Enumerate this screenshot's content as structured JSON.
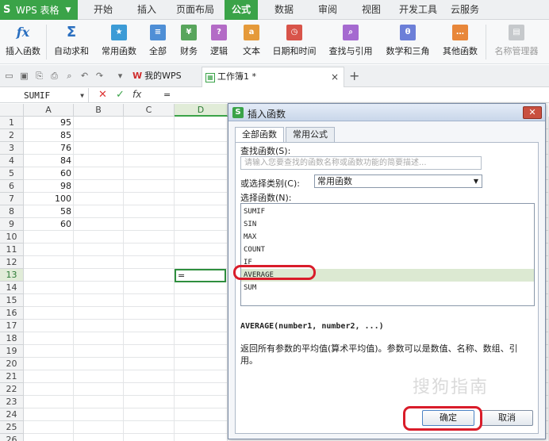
{
  "app": {
    "brand": "WPS 表格"
  },
  "menu": {
    "tabs": [
      "开始",
      "插入",
      "页面布局",
      "公式",
      "数据",
      "审阅",
      "视图",
      "开发工具",
      "云服务"
    ],
    "active": "公式"
  },
  "ribbon": {
    "insert_function": "插入函数",
    "autosum": "自动求和",
    "common": "常用函数",
    "all": "全部",
    "finance": "财务",
    "logic": "逻辑",
    "text": "文本",
    "datetime": "日期和时间",
    "lookup": "查找与引用",
    "math": "数学和三角",
    "other": "其他函数",
    "name_manager": "名称管理器"
  },
  "tabs": {
    "mywps": "我的WPS",
    "workbook": "工作簿1 *"
  },
  "formula_bar": {
    "name_box": "SUMIF",
    "fx": "fx",
    "value": "="
  },
  "sheet": {
    "columns": [
      "A",
      "B",
      "C",
      "D"
    ],
    "rows": [
      "1",
      "2",
      "3",
      "4",
      "5",
      "6",
      "7",
      "8",
      "9",
      "10",
      "11",
      "12",
      "13",
      "14",
      "15",
      "16",
      "17",
      "18",
      "19",
      "20",
      "21",
      "22",
      "23",
      "24",
      "25",
      "26"
    ],
    "values_a": [
      "95",
      "85",
      "76",
      "84",
      "60",
      "98",
      "100",
      "58",
      "60"
    ],
    "active_cell_text": "="
  },
  "dialog": {
    "title": "插入函数",
    "tab_all": "全部函数",
    "tab_common": "常用公式",
    "search_label": "查找函数(S):",
    "search_placeholder": "请输入您要查找的函数名称或函数功能的简要描述...",
    "category_label": "或选择类别(C):",
    "category_value": "常用函数",
    "list_label": "选择函数(N):",
    "functions": [
      "SUMIF",
      "SIN",
      "MAX",
      "COUNT",
      "IF",
      "AVERAGE",
      "SUM"
    ],
    "selected": "AVERAGE",
    "signature": "AVERAGE(number1, number2, ...)",
    "description": "返回所有参数的平均值(算术平均值)。参数可以是数值、名称、数组、引用。",
    "ok": "确定",
    "cancel": "取消"
  },
  "watermark": "搜狗指南",
  "colors": {
    "accent": "#3aa348",
    "highlight": "#d91c2a"
  }
}
